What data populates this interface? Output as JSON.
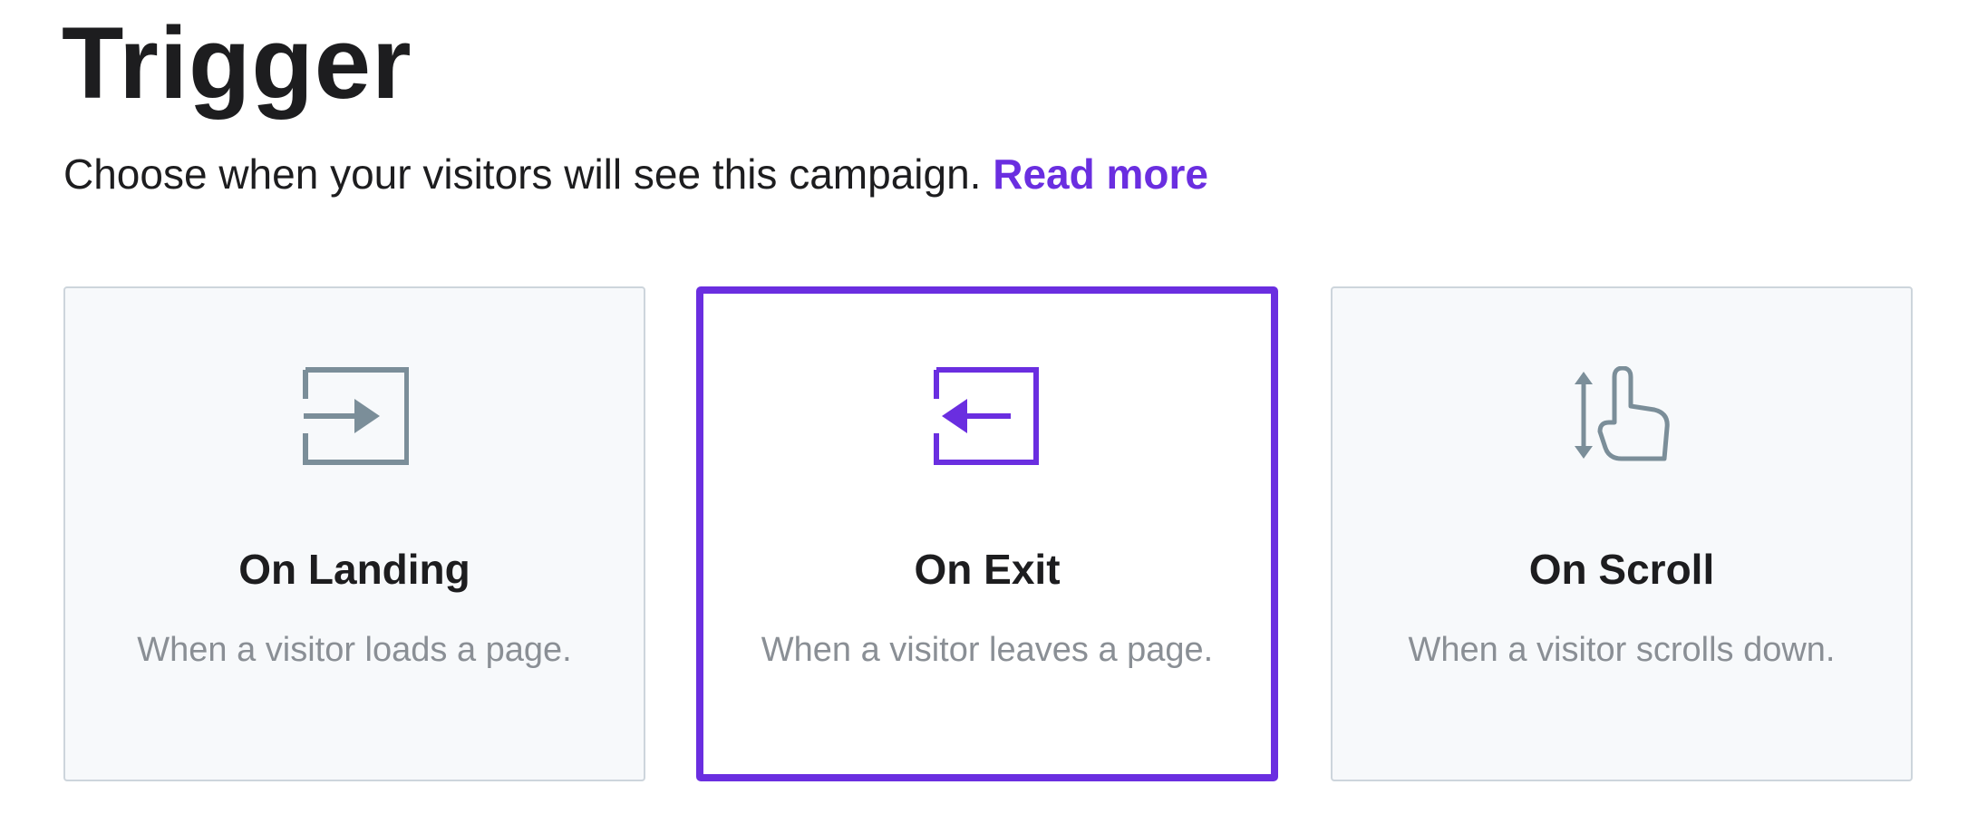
{
  "header": {
    "title": "Trigger",
    "subtitle": "Choose when your visitors will see this campaign.",
    "read_more": "Read more"
  },
  "colors": {
    "accent": "#6a2ee0",
    "icon_inactive": "#7b8e99",
    "card_border": "#cdd5dc",
    "card_background": "#f7f9fb",
    "description_text": "#8a8f95"
  },
  "triggers": [
    {
      "icon": "enter-icon",
      "title": "On Landing",
      "description": "When a visitor loads a page.",
      "selected": false
    },
    {
      "icon": "exit-icon",
      "title": "On Exit",
      "description": "When a visitor leaves a page.",
      "selected": true
    },
    {
      "icon": "scroll-hand-icon",
      "title": "On Scroll",
      "description": "When a visitor scrolls down.",
      "selected": false
    }
  ]
}
